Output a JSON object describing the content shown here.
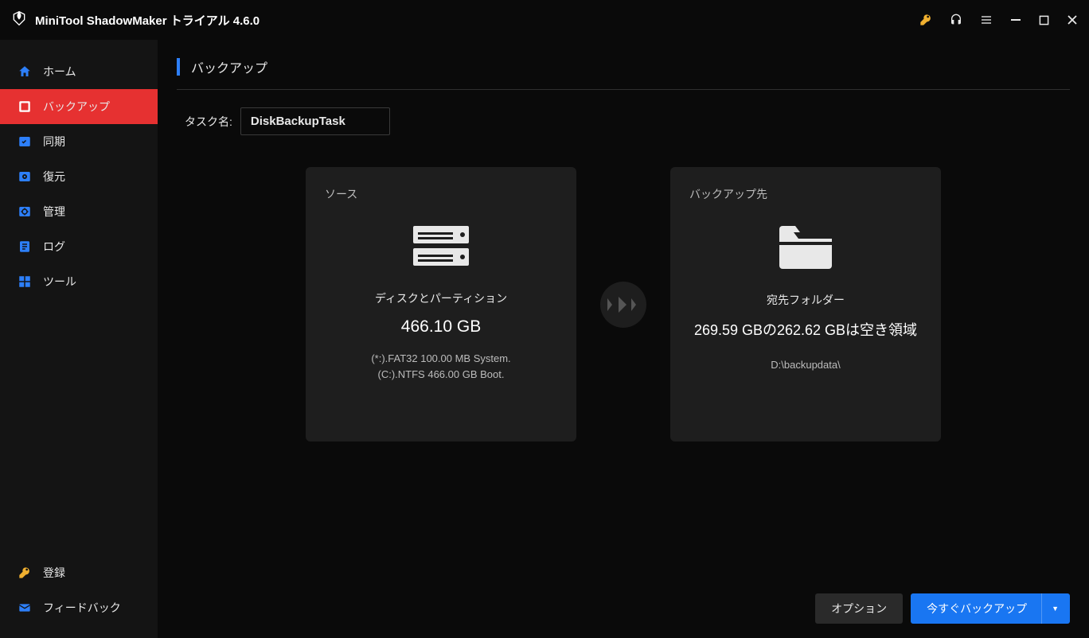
{
  "titlebar": {
    "app_title": "MiniTool ShadowMaker トライアル 4.6.0"
  },
  "sidebar": {
    "items": [
      {
        "label": "ホーム"
      },
      {
        "label": "バックアップ"
      },
      {
        "label": "同期"
      },
      {
        "label": "復元"
      },
      {
        "label": "管理"
      },
      {
        "label": "ログ"
      },
      {
        "label": "ツール"
      }
    ],
    "bottom": {
      "register": "登録",
      "feedback": "フィードバック"
    }
  },
  "page": {
    "title": "バックアップ",
    "taskname_label": "タスク名:",
    "taskname_value": "DiskBackupTask"
  },
  "source": {
    "title": "ソース",
    "subtitle": "ディスクとパーティション",
    "size": "466.10 GB",
    "detail_line1": "(*:).FAT32 100.00 MB System.",
    "detail_line2": "(C:).NTFS 466.00 GB Boot."
  },
  "dest": {
    "title": "バックアップ先",
    "subtitle": "宛先フォルダー",
    "space_line": "269.59 GBの262.62 GBは空き領域",
    "path": "D:\\backupdata\\"
  },
  "buttons": {
    "options": "オプション",
    "backup_now": "今すぐバックアップ"
  }
}
